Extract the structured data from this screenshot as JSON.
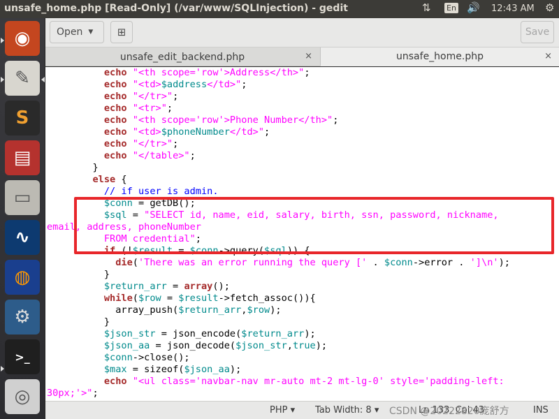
{
  "window": {
    "title": "unsafe_home.php [Read-Only] (/var/www/SQLInjection) - gedit"
  },
  "tray": {
    "sort_icon": "⇅",
    "keyboard": "En",
    "volume_icon": "🔊",
    "time": "12:43 AM",
    "gear_icon": "⚙"
  },
  "launcher": {
    "items": [
      "ubuntu-logo",
      "text-editor",
      "sublime-text",
      "database-tool",
      "file-cabinet",
      "wireshark",
      "firefox",
      "system-settings",
      "terminal",
      "disk-drive"
    ],
    "glyphs": [
      "◉",
      "✎",
      "S",
      "▤",
      "▭",
      "∿",
      "◍",
      "⚙",
      ">_",
      "◎"
    ]
  },
  "toolbar": {
    "open_label": "Open",
    "open_caret": "▼",
    "new_tab_icon": "⊞",
    "save_label": "Save"
  },
  "tabs": [
    {
      "label": "unsafe_edit_backend.php",
      "close": "×"
    },
    {
      "label": "unsafe_home.php",
      "close": "×"
    }
  ],
  "code_lines": [
    {
      "indent": "          ",
      "tokens": [
        {
          "t": "k",
          "v": "echo"
        },
        {
          "t": "s",
          "v": " \"<th scope='row'>Address</th>\""
        },
        {
          "t": "p",
          "v": ";"
        }
      ]
    },
    {
      "indent": "          ",
      "tokens": [
        {
          "t": "k",
          "v": "echo"
        },
        {
          "t": "s",
          "v": " \"<td>"
        },
        {
          "t": "v",
          "v": "$address"
        },
        {
          "t": "s",
          "v": "</td>\""
        },
        {
          "t": "p",
          "v": ";"
        }
      ]
    },
    {
      "indent": "          ",
      "tokens": [
        {
          "t": "k",
          "v": "echo"
        },
        {
          "t": "s",
          "v": " \"</tr>\""
        },
        {
          "t": "p",
          "v": ";"
        }
      ]
    },
    {
      "indent": "          ",
      "tokens": [
        {
          "t": "k",
          "v": "echo"
        },
        {
          "t": "s",
          "v": " \"<tr>\""
        },
        {
          "t": "p",
          "v": ";"
        }
      ]
    },
    {
      "indent": "          ",
      "tokens": [
        {
          "t": "k",
          "v": "echo"
        },
        {
          "t": "s",
          "v": " \"<th scope='row'>Phone Number</th>\""
        },
        {
          "t": "p",
          "v": ";"
        }
      ]
    },
    {
      "indent": "          ",
      "tokens": [
        {
          "t": "k",
          "v": "echo"
        },
        {
          "t": "s",
          "v": " \"<td>"
        },
        {
          "t": "v",
          "v": "$phoneNumber"
        },
        {
          "t": "s",
          "v": "</td>\""
        },
        {
          "t": "p",
          "v": ";"
        }
      ]
    },
    {
      "indent": "          ",
      "tokens": [
        {
          "t": "k",
          "v": "echo"
        },
        {
          "t": "s",
          "v": " \"</tr>\""
        },
        {
          "t": "p",
          "v": ";"
        }
      ]
    },
    {
      "indent": "          ",
      "tokens": [
        {
          "t": "k",
          "v": "echo"
        },
        {
          "t": "s",
          "v": " \"</table>\""
        },
        {
          "t": "p",
          "v": ";"
        }
      ]
    },
    {
      "indent": "        ",
      "tokens": [
        {
          "t": "p",
          "v": "}"
        }
      ]
    },
    {
      "indent": "        ",
      "tokens": [
        {
          "t": "k",
          "v": "else"
        },
        {
          "t": "p",
          "v": " {"
        }
      ]
    },
    {
      "indent": "          ",
      "tokens": [
        {
          "t": "c",
          "v": "// if user is admin."
        }
      ]
    },
    {
      "indent": "          ",
      "tokens": [
        {
          "t": "v",
          "v": "$conn"
        },
        {
          "t": "p",
          "v": " = getDB();"
        }
      ]
    },
    {
      "indent": "          ",
      "tokens": [
        {
          "t": "v",
          "v": "$sql"
        },
        {
          "t": "p",
          "v": " = "
        },
        {
          "t": "s",
          "v": "\"SELECT id, name, eid, salary, birth, ssn, password, nickname,"
        }
      ]
    },
    {
      "indent": "",
      "tokens": [
        {
          "t": "s",
          "v": "email, address, phoneNumber"
        }
      ]
    },
    {
      "indent": "          ",
      "tokens": [
        {
          "t": "s",
          "v": "FROM credential\""
        },
        {
          "t": "p",
          "v": ";"
        }
      ]
    },
    {
      "indent": "          ",
      "tokens": [
        {
          "t": "k",
          "v": "if"
        },
        {
          "t": "p",
          "v": " (!"
        },
        {
          "t": "v",
          "v": "$result"
        },
        {
          "t": "p",
          "v": " = "
        },
        {
          "t": "v",
          "v": "$conn"
        },
        {
          "t": "p",
          "v": "->query("
        },
        {
          "t": "v",
          "v": "$sql"
        },
        {
          "t": "p",
          "v": ")) {"
        }
      ]
    },
    {
      "indent": "            ",
      "tokens": [
        {
          "t": "k",
          "v": "die"
        },
        {
          "t": "p",
          "v": "("
        },
        {
          "t": "s",
          "v": "'There was an error running the query ['"
        },
        {
          "t": "p",
          "v": " . "
        },
        {
          "t": "v",
          "v": "$conn"
        },
        {
          "t": "p",
          "v": "->error . "
        },
        {
          "t": "s",
          "v": "']\\n'"
        },
        {
          "t": "p",
          "v": ");"
        }
      ]
    },
    {
      "indent": "          ",
      "tokens": [
        {
          "t": "p",
          "v": "}"
        }
      ]
    },
    {
      "indent": "          ",
      "tokens": [
        {
          "t": "v",
          "v": "$return_arr"
        },
        {
          "t": "p",
          "v": " = "
        },
        {
          "t": "k",
          "v": "array"
        },
        {
          "t": "p",
          "v": "();"
        }
      ]
    },
    {
      "indent": "          ",
      "tokens": [
        {
          "t": "k",
          "v": "while"
        },
        {
          "t": "p",
          "v": "("
        },
        {
          "t": "v",
          "v": "$row"
        },
        {
          "t": "p",
          "v": " = "
        },
        {
          "t": "v",
          "v": "$result"
        },
        {
          "t": "p",
          "v": "->fetch_assoc()){"
        }
      ]
    },
    {
      "indent": "            ",
      "tokens": [
        {
          "t": "p",
          "v": "array_push("
        },
        {
          "t": "v",
          "v": "$return_arr"
        },
        {
          "t": "p",
          "v": ","
        },
        {
          "t": "v",
          "v": "$row"
        },
        {
          "t": "p",
          "v": ");"
        }
      ]
    },
    {
      "indent": "          ",
      "tokens": [
        {
          "t": "p",
          "v": "}"
        }
      ]
    },
    {
      "indent": "          ",
      "tokens": [
        {
          "t": "v",
          "v": "$json_str"
        },
        {
          "t": "p",
          "v": " = json_encode("
        },
        {
          "t": "v",
          "v": "$return_arr"
        },
        {
          "t": "p",
          "v": ");"
        }
      ]
    },
    {
      "indent": "          ",
      "tokens": [
        {
          "t": "v",
          "v": "$json_aa"
        },
        {
          "t": "p",
          "v": " = json_decode("
        },
        {
          "t": "v",
          "v": "$json_str"
        },
        {
          "t": "p",
          "v": ","
        },
        {
          "t": "v",
          "v": "true"
        },
        {
          "t": "p",
          "v": ");"
        }
      ]
    },
    {
      "indent": "          ",
      "tokens": [
        {
          "t": "v",
          "v": "$conn"
        },
        {
          "t": "p",
          "v": "->close();"
        }
      ]
    },
    {
      "indent": "          ",
      "tokens": [
        {
          "t": "v",
          "v": "$max"
        },
        {
          "t": "p",
          "v": " = sizeof("
        },
        {
          "t": "v",
          "v": "$json_aa"
        },
        {
          "t": "p",
          "v": ");"
        }
      ]
    },
    {
      "indent": "          ",
      "tokens": [
        {
          "t": "k",
          "v": "echo"
        },
        {
          "t": "s",
          "v": " \"<ul class='navbar-nav mr-auto mt-2 mt-lg-0' style='padding-left:"
        }
      ]
    },
    {
      "indent": "",
      "tokens": [
        {
          "t": "s",
          "v": "30px;'>\""
        },
        {
          "t": "p",
          "v": ";"
        }
      ]
    }
  ],
  "statusbar": {
    "language": "PHP ▾",
    "tab_width": "Tab Width: 8 ▾",
    "position": "Ln 133, Col 43",
    "ins": "INS",
    "watermark": "CSDN @20222820庞舒方"
  }
}
